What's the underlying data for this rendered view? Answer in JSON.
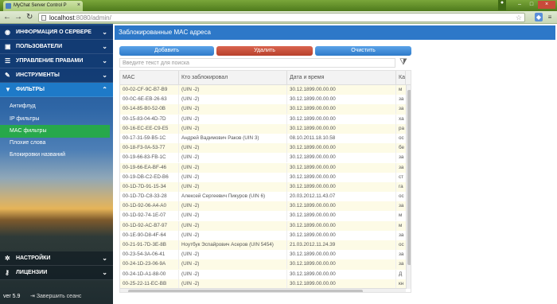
{
  "browser": {
    "tab_title": "MyChat Server Control P",
    "tab_close": "×",
    "url_host": "localhost",
    "url_path": ":8080/admin/",
    "nav_back": "←",
    "nav_forward": "→",
    "nav_reload": "↻",
    "star": "☆",
    "window_minimize": "–",
    "window_maximize": "□",
    "window_close": "×"
  },
  "sidebar": {
    "top_items": [
      {
        "label": "ИНФОРМАЦИЯ О СЕРВЕРЕ",
        "icon": "globe-icon",
        "glyph": "◉",
        "chevron": "⌄"
      },
      {
        "label": "ПОЛЬЗОВАТЕЛИ",
        "icon": "users-icon",
        "glyph": "▣",
        "chevron": "⌄"
      },
      {
        "label": "УПРАВЛЕНИЕ ПРАВАМИ",
        "icon": "list-icon",
        "glyph": "☰",
        "chevron": "⌄"
      },
      {
        "label": "ИНСТРУМЕНТЫ",
        "icon": "wrench-icon",
        "glyph": "✎",
        "chevron": "⌄"
      },
      {
        "label": "ФИЛЬТРЫ",
        "icon": "filter-icon",
        "glyph": "▼",
        "chevron": "⌃"
      }
    ],
    "sub_items": [
      {
        "label": "Антифлуд"
      },
      {
        "label": "IP фильтры"
      },
      {
        "label": "MAC фильтры"
      },
      {
        "label": "Плохие слова"
      },
      {
        "label": "Блокировки названий"
      }
    ],
    "bottom_items": [
      {
        "label": "НАСТРОЙКИ",
        "icon": "gears-icon",
        "glyph": "✲",
        "chevron": "⌄"
      },
      {
        "label": "ЛИЦЕНЗИИ",
        "icon": "key-icon",
        "glyph": "⚷",
        "chevron": "⌄"
      }
    ],
    "version": "ver 5.9",
    "logout": "Завершить сеанс"
  },
  "main": {
    "title": "Заблокированные MAC адреса",
    "buttons": {
      "add": "Добавить",
      "delete": "Удалить",
      "clear": "Очистить"
    },
    "search_placeholder": "Введите текст для поиска",
    "columns": [
      "MAC",
      "Кто заблокировал",
      "Дата и время",
      "Ка"
    ],
    "rows": [
      [
        "00-02-CF-9C-B7-B9",
        "(UIN -2)",
        "30.12.1899.00.00.00",
        "м"
      ],
      [
        "00-0C-6E-EB-26-63",
        "(UIN -2)",
        "30.12.1899.00.00.00",
        "за"
      ],
      [
        "00-14-85-B0-52-0B",
        "(UIN -2)",
        "30.12.1899.00.00.00",
        "за"
      ],
      [
        "00-15-83-04-4D-7D",
        "(UIN -2)",
        "30.12.1899.00.00.00",
        "ха"
      ],
      [
        "00-16-EC-EE-C9-E5",
        "(UIN -2)",
        "30.12.1899.00.00.00",
        "ра"
      ],
      [
        "00-17-31-59-B5-1C",
        "Андрей Вадимович Раков (UIN 3)",
        "08.10.2011.18.10.58",
        "ос"
      ],
      [
        "00-18-F3-0A-53-77",
        "(UIN -2)",
        "30.12.1899.00.00.00",
        "бе"
      ],
      [
        "00-19-66-83-FB-1C",
        "(UIN -2)",
        "30.12.1899.00.00.00",
        "за"
      ],
      [
        "00-19-66-EA-BF-46",
        "(UIN -2)",
        "30.12.1899.00.00.00",
        "за"
      ],
      [
        "00-19-DB-C2-ED-B6",
        "(UIN -2)",
        "30.12.1899.00.00.00",
        "ст"
      ],
      [
        "00-1D-7D-91-15-34",
        "(UIN -2)",
        "30.12.1899.00.00.00",
        "га"
      ],
      [
        "00-1D-7D-C8-33-28",
        "Алексей Сергеевич Пикуров (UIN 6)",
        "20.03.2012.11.43.07",
        "ос"
      ],
      [
        "00-1D-92-06-A4-A0",
        "(UIN -2)",
        "30.12.1899.00.00.00",
        "за"
      ],
      [
        "00-1D-92-74-1E-07",
        "(UIN -2)",
        "30.12.1899.00.00.00",
        "м"
      ],
      [
        "00-1D-92-AC-B7-97",
        "(UIN -2)",
        "30.12.1899.00.00.00",
        "м"
      ],
      [
        "00-1E-90-D8-4F-64",
        "(UIN -2)",
        "30.12.1899.00.00.00",
        "за"
      ],
      [
        "00-21-91-7D-3E-8B",
        "Ноутбук Эспайрович Асеров (UIN 5454)",
        "21.03.2012.11.24.39",
        "ос"
      ],
      [
        "00-23-54-3A-06-41",
        "(UIN -2)",
        "30.12.1899.00.00.00",
        "за"
      ],
      [
        "00-24-1D-23-06-9A",
        "(UIN -2)",
        "30.12.1899.00.00.00",
        "за"
      ],
      [
        "00-24-1D-A1-88-00",
        "(UIN -2)",
        "30.12.1899.00.00.00",
        "Д"
      ],
      [
        "00-25-22-11-EC-BB",
        "(UIN -2)",
        "30.12.1899.00.00.00",
        "кн"
      ]
    ]
  }
}
